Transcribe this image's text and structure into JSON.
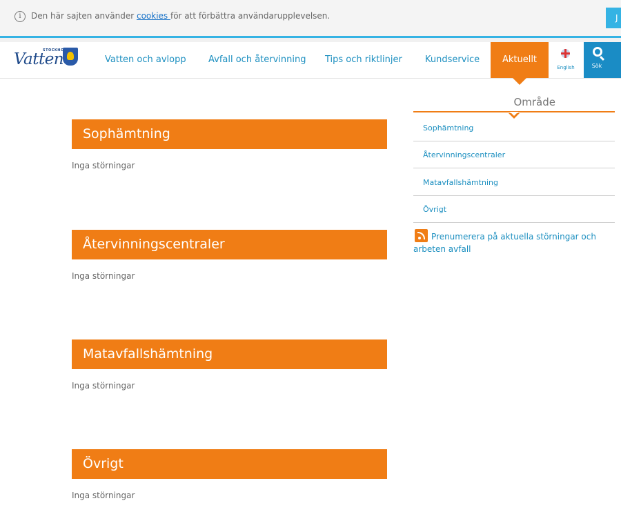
{
  "cookie_bar": {
    "info_icon": "info-icon",
    "text_before": "Den här sajten använder ",
    "link_text": "cookies ",
    "text_after": "för att förbättra användarupplevelsen.",
    "accept_label": "J"
  },
  "header": {
    "logo_small": "STOCKHOLM",
    "logo_word": "Vatten",
    "nav": [
      "Vatten och avlopp",
      "Avfall och återvinning",
      "Tips och riktlinjer",
      "Kundservice",
      "Aktuellt"
    ],
    "language_label": "English",
    "search_label": "Sök"
  },
  "sections": [
    {
      "title": "Sophämtning",
      "status": "Inga störningar"
    },
    {
      "title": "Återvinningscentraler",
      "status": "Inga störningar"
    },
    {
      "title": "Matavfallshämtning",
      "status": "Inga störningar"
    },
    {
      "title": "Övrigt",
      "status": "Inga störningar"
    }
  ],
  "sidebar": {
    "title": "Område",
    "items": [
      "Sophämtning",
      "Återvinningscentraler",
      "Matavfallshämtning",
      "Övrigt"
    ],
    "rss_text": "Prenumerera på aktuella störningar och arbeten avfall"
  },
  "colors": {
    "accent_orange": "#f07d15",
    "link_blue": "#1c8fc0",
    "search_blue": "#1a8cc5"
  }
}
